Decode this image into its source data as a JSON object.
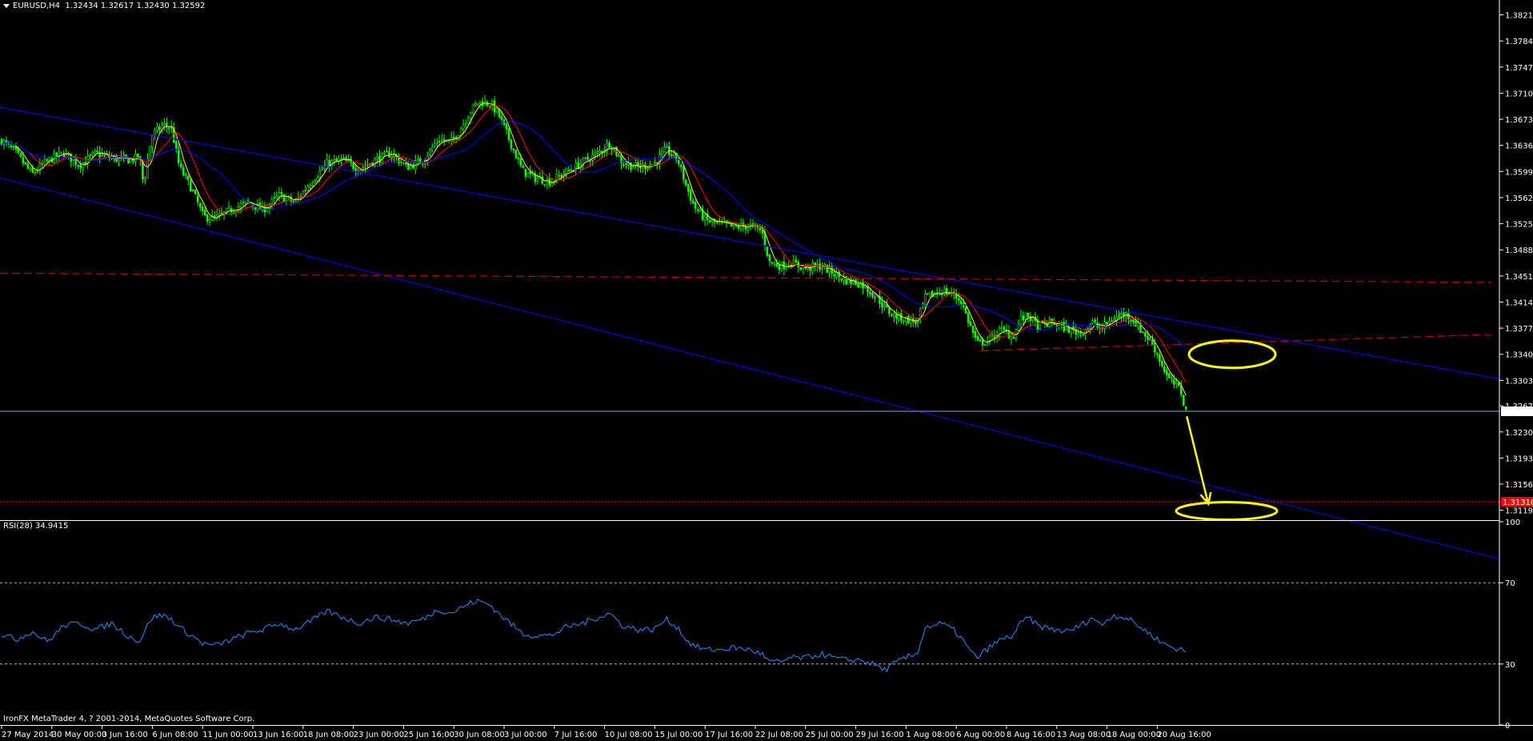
{
  "header": {
    "symbol": "EURUSD,H4",
    "ohlc": "1.32434 1.32617 1.32430 1.32592",
    "menu_icon": "triangle-down-icon"
  },
  "rsi_header": "RSI(28) 34.9415",
  "footer": "IronFX MetaTrader 4, ? 2001-2014, MetaQuotes Software Corp.",
  "colors": {
    "background": "#000000",
    "candle": "#00ff00",
    "ma_fast": "#ffff00",
    "ma_mid": "#ff0000",
    "ma_slow": "#0000ff",
    "channel": "#0000cd",
    "support": "#c00000",
    "annotation": "#ffff00",
    "rsi": "#1e90ff",
    "bid": "#8fa0d8",
    "target": "#ff0000"
  },
  "chart_data": [
    {
      "type": "candlestick",
      "title": "EURUSD,H4",
      "ylim": [
        1.3105,
        1.3842
      ],
      "price_ticks": [
        "1.38210",
        "1.37840",
        "1.37470",
        "1.37100",
        "1.36730",
        "1.36360",
        "1.35990",
        "1.35620",
        "1.35250",
        "1.34880",
        "1.34510",
        "1.34140",
        "1.33770",
        "1.33400",
        "1.33030",
        "1.32670",
        "1.32300",
        "1.31930",
        "1.31560",
        "1.31190"
      ],
      "current_price": "1.32592",
      "target_level": "1.31310",
      "x_ticks": [
        "27 May 2014",
        "30 May 00:00",
        "3 Jun 16:00",
        "6 Jun 08:00",
        "11 Jun 00:00",
        "13 Jun 16:00",
        "18 Jun 08:00",
        "23 Jun 00:00",
        "25 Jun 16:00",
        "30 Jun 08:00",
        "3 Jul 00:00",
        "7 Jul 16:00",
        "10 Jul 08:00",
        "15 Jul 00:00",
        "17 Jul 16:00",
        "22 Jul 08:00",
        "25 Jul 00:00",
        "29 Jul 16:00",
        "1 Aug 08:00",
        "6 Aug 00:00",
        "8 Aug 16:00",
        "13 Aug 08:00",
        "18 Aug 00:00",
        "20 Aug 16:00"
      ],
      "close_path": [
        [
          0,
          1.3645
        ],
        [
          20,
          1.3625
        ],
        [
          40,
          1.3595
        ],
        [
          60,
          1.3615
        ],
        [
          80,
          1.3625
        ],
        [
          100,
          1.3608
        ],
        [
          120,
          1.3625
        ],
        [
          140,
          1.3618
        ],
        [
          160,
          1.3615
        ],
        [
          175,
          1.362
        ],
        [
          180,
          1.358
        ],
        [
          190,
          1.365
        ],
        [
          205,
          1.3665
        ],
        [
          215,
          1.366
        ],
        [
          225,
          1.3605
        ],
        [
          240,
          1.3575
        ],
        [
          255,
          1.3535
        ],
        [
          270,
          1.3532
        ],
        [
          290,
          1.3545
        ],
        [
          310,
          1.3555
        ],
        [
          330,
          1.3545
        ],
        [
          350,
          1.3565
        ],
        [
          370,
          1.3555
        ],
        [
          390,
          1.3585
        ],
        [
          410,
          1.361
        ],
        [
          430,
          1.3615
        ],
        [
          450,
          1.3602
        ],
        [
          470,
          1.3615
        ],
        [
          490,
          1.3625
        ],
        [
          510,
          1.3605
        ],
        [
          530,
          1.3615
        ],
        [
          550,
          1.3645
        ],
        [
          565,
          1.364
        ],
        [
          575,
          1.3655
        ],
        [
          590,
          1.3685
        ],
        [
          600,
          1.3698
        ],
        [
          615,
          1.3695
        ],
        [
          625,
          1.368
        ],
        [
          640,
          1.364
        ],
        [
          655,
          1.36
        ],
        [
          670,
          1.359
        ],
        [
          690,
          1.3585
        ],
        [
          710,
          1.3598
        ],
        [
          730,
          1.3612
        ],
        [
          750,
          1.3625
        ],
        [
          765,
          1.364
        ],
        [
          780,
          1.3612
        ],
        [
          800,
          1.3605
        ],
        [
          820,
          1.361
        ],
        [
          835,
          1.363
        ],
        [
          850,
          1.3615
        ],
        [
          860,
          1.358
        ],
        [
          870,
          1.355
        ],
        [
          885,
          1.353
        ],
        [
          900,
          1.3525
        ],
        [
          920,
          1.352
        ],
        [
          940,
          1.3522
        ],
        [
          955,
          1.3515
        ],
        [
          965,
          1.347
        ],
        [
          980,
          1.3465
        ],
        [
          990,
          1.347
        ],
        [
          1010,
          1.3462
        ],
        [
          1030,
          1.3465
        ],
        [
          1045,
          1.3455
        ],
        [
          1060,
          1.3445
        ],
        [
          1080,
          1.344
        ],
        [
          1100,
          1.342
        ],
        [
          1110,
          1.3405
        ],
        [
          1120,
          1.3395
        ],
        [
          1135,
          1.339
        ],
        [
          1150,
          1.3385
        ],
        [
          1160,
          1.342
        ],
        [
          1180,
          1.343
        ],
        [
          1195,
          1.3425
        ],
        [
          1205,
          1.3415
        ],
        [
          1215,
          1.3385
        ],
        [
          1225,
          1.3355
        ],
        [
          1240,
          1.336
        ],
        [
          1255,
          1.3375
        ],
        [
          1270,
          1.3365
        ],
        [
          1280,
          1.339
        ],
        [
          1290,
          1.3395
        ],
        [
          1300,
          1.338
        ],
        [
          1320,
          1.3385
        ],
        [
          1340,
          1.3375
        ],
        [
          1355,
          1.337
        ],
        [
          1370,
          1.3385
        ],
        [
          1380,
          1.3375
        ],
        [
          1395,
          1.339
        ],
        [
          1410,
          1.3398
        ],
        [
          1420,
          1.339
        ],
        [
          1430,
          1.3375
        ],
        [
          1445,
          1.3355
        ],
        [
          1455,
          1.333
        ],
        [
          1465,
          1.3305
        ],
        [
          1480,
          1.329
        ],
        [
          1488,
          1.3255
        ]
      ],
      "overlays": {
        "channel_upper": [
          [
            0,
            1.369
          ],
          [
            1880,
            1.3305
          ]
        ],
        "channel_lower": [
          [
            0,
            1.359
          ],
          [
            1880,
            1.305
          ]
        ],
        "dashed_red_horizontal": [
          [
            0,
            1.3455
          ],
          [
            1870,
            1.3442
          ]
        ],
        "dashed_red_rising": [
          [
            1230,
            1.3345
          ],
          [
            1870,
            1.3368
          ]
        ],
        "ellipse_1": {
          "cx": 1545,
          "price": 1.334
        },
        "ellipse_2": {
          "cx": 1538,
          "price": 1.3118
        },
        "arrow": {
          "from": [
            1488,
            1.3252
          ],
          "to": [
            1515,
            1.3128
          ]
        }
      }
    },
    {
      "type": "line",
      "title": "RSI(28) 34.9415",
      "ylim": [
        0,
        100
      ],
      "y_ticks": [
        "100",
        "70",
        "30",
        "0"
      ],
      "levels": [
        70,
        30
      ],
      "values_path": [
        [
          0,
          45
        ],
        [
          20,
          42
        ],
        [
          40,
          46
        ],
        [
          60,
          41
        ],
        [
          80,
          49
        ],
        [
          100,
          50
        ],
        [
          120,
          47
        ],
        [
          140,
          50
        ],
        [
          160,
          44
        ],
        [
          175,
          41
        ],
        [
          180,
          45
        ],
        [
          190,
          53
        ],
        [
          205,
          54
        ],
        [
          215,
          52
        ],
        [
          225,
          48
        ],
        [
          240,
          44
        ],
        [
          255,
          40
        ],
        [
          270,
          39
        ],
        [
          290,
          42
        ],
        [
          310,
          45
        ],
        [
          330,
          47
        ],
        [
          350,
          50
        ],
        [
          370,
          47
        ],
        [
          390,
          51
        ],
        [
          410,
          56
        ],
        [
          430,
          53
        ],
        [
          450,
          50
        ],
        [
          470,
          53
        ],
        [
          490,
          52
        ],
        [
          510,
          50
        ],
        [
          530,
          52
        ],
        [
          550,
          57
        ],
        [
          565,
          55
        ],
        [
          575,
          57
        ],
        [
          590,
          60
        ],
        [
          600,
          61
        ],
        [
          615,
          59
        ],
        [
          625,
          55
        ],
        [
          640,
          50
        ],
        [
          655,
          45
        ],
        [
          670,
          44
        ],
        [
          690,
          44
        ],
        [
          710,
          48
        ],
        [
          730,
          50
        ],
        [
          750,
          53
        ],
        [
          765,
          55
        ],
        [
          780,
          49
        ],
        [
          800,
          47
        ],
        [
          820,
          47
        ],
        [
          835,
          52
        ],
        [
          850,
          48
        ],
        [
          860,
          42
        ],
        [
          870,
          39
        ],
        [
          885,
          37
        ],
        [
          900,
          37
        ],
        [
          920,
          38
        ],
        [
          940,
          37
        ],
        [
          955,
          35
        ],
        [
          965,
          31
        ],
        [
          980,
          31
        ],
        [
          990,
          33
        ],
        [
          1010,
          33
        ],
        [
          1030,
          35
        ],
        [
          1045,
          33
        ],
        [
          1060,
          32
        ],
        [
          1080,
          32
        ],
        [
          1100,
          29
        ],
        [
          1110,
          27
        ],
        [
          1120,
          30
        ],
        [
          1135,
          33
        ],
        [
          1150,
          35
        ],
        [
          1160,
          48
        ],
        [
          1180,
          50
        ],
        [
          1195,
          47
        ],
        [
          1205,
          43
        ],
        [
          1215,
          37
        ],
        [
          1225,
          33
        ],
        [
          1240,
          38
        ],
        [
          1255,
          42
        ],
        [
          1270,
          44
        ],
        [
          1280,
          50
        ],
        [
          1290,
          53
        ],
        [
          1300,
          49
        ],
        [
          1320,
          47
        ],
        [
          1340,
          46
        ],
        [
          1355,
          49
        ],
        [
          1370,
          53
        ],
        [
          1380,
          49
        ],
        [
          1395,
          54
        ],
        [
          1410,
          53
        ],
        [
          1420,
          51
        ],
        [
          1430,
          48
        ],
        [
          1445,
          44
        ],
        [
          1455,
          41
        ],
        [
          1465,
          39
        ],
        [
          1480,
          37
        ],
        [
          1488,
          36
        ]
      ]
    }
  ]
}
